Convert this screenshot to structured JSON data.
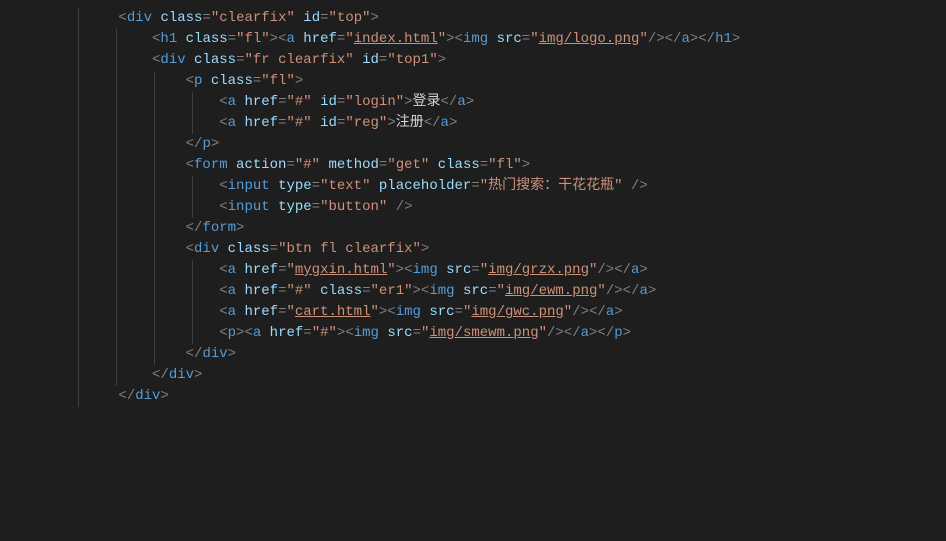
{
  "lines": [
    {
      "indent": 1,
      "segs": [
        {
          "t": "tag",
          "v": "<"
        },
        {
          "t": "tagname",
          "v": "div"
        },
        {
          "t": "txt",
          "v": " "
        },
        {
          "t": "attrname",
          "v": "class"
        },
        {
          "t": "tag",
          "v": "="
        },
        {
          "t": "attrval",
          "v": "\"clearfix\""
        },
        {
          "t": "txt",
          "v": " "
        },
        {
          "t": "attrname",
          "v": "id"
        },
        {
          "t": "tag",
          "v": "="
        },
        {
          "t": "attrval",
          "v": "\"top\""
        },
        {
          "t": "tag",
          "v": ">"
        }
      ]
    },
    {
      "indent": 2,
      "segs": [
        {
          "t": "tag",
          "v": "<"
        },
        {
          "t": "tagname",
          "v": "h1"
        },
        {
          "t": "txt",
          "v": " "
        },
        {
          "t": "attrname",
          "v": "class"
        },
        {
          "t": "tag",
          "v": "="
        },
        {
          "t": "attrval",
          "v": "\"fl\""
        },
        {
          "t": "tag",
          "v": "><"
        },
        {
          "t": "tagname",
          "v": "a"
        },
        {
          "t": "txt",
          "v": " "
        },
        {
          "t": "attrname",
          "v": "href"
        },
        {
          "t": "tag",
          "v": "="
        },
        {
          "t": "attrval",
          "v": "\""
        },
        {
          "t": "attrvalU",
          "v": "index.html"
        },
        {
          "t": "attrval",
          "v": "\""
        },
        {
          "t": "tag",
          "v": "><"
        },
        {
          "t": "tagname",
          "v": "img"
        },
        {
          "t": "txt",
          "v": " "
        },
        {
          "t": "attrname",
          "v": "src"
        },
        {
          "t": "tag",
          "v": "="
        },
        {
          "t": "attrval",
          "v": "\""
        },
        {
          "t": "attrvalU",
          "v": "img/logo.png"
        },
        {
          "t": "attrval",
          "v": "\""
        },
        {
          "t": "tag",
          "v": "/></"
        },
        {
          "t": "tagname",
          "v": "a"
        },
        {
          "t": "tag",
          "v": "></"
        },
        {
          "t": "tagname",
          "v": "h1"
        },
        {
          "t": "tag",
          "v": ">"
        }
      ]
    },
    {
      "indent": 2,
      "segs": [
        {
          "t": "tag",
          "v": "<"
        },
        {
          "t": "tagname",
          "v": "div"
        },
        {
          "t": "txt",
          "v": " "
        },
        {
          "t": "attrname",
          "v": "class"
        },
        {
          "t": "tag",
          "v": "="
        },
        {
          "t": "attrval",
          "v": "\"fr clearfix\""
        },
        {
          "t": "txt",
          "v": " "
        },
        {
          "t": "attrname",
          "v": "id"
        },
        {
          "t": "tag",
          "v": "="
        },
        {
          "t": "attrval",
          "v": "\"top1\""
        },
        {
          "t": "tag",
          "v": ">"
        }
      ]
    },
    {
      "indent": 3,
      "segs": [
        {
          "t": "tag",
          "v": "<"
        },
        {
          "t": "tagname",
          "v": "p"
        },
        {
          "t": "txt",
          "v": " "
        },
        {
          "t": "attrname",
          "v": "class"
        },
        {
          "t": "tag",
          "v": "="
        },
        {
          "t": "attrval",
          "v": "\"fl\""
        },
        {
          "t": "tag",
          "v": ">"
        }
      ]
    },
    {
      "indent": 4,
      "segs": [
        {
          "t": "tag",
          "v": "<"
        },
        {
          "t": "tagname",
          "v": "a"
        },
        {
          "t": "txt",
          "v": " "
        },
        {
          "t": "attrname",
          "v": "href"
        },
        {
          "t": "tag",
          "v": "="
        },
        {
          "t": "attrval",
          "v": "\"#\""
        },
        {
          "t": "txt",
          "v": " "
        },
        {
          "t": "attrname",
          "v": "id"
        },
        {
          "t": "tag",
          "v": "="
        },
        {
          "t": "attrval",
          "v": "\"login\""
        },
        {
          "t": "tag",
          "v": ">"
        },
        {
          "t": "txt",
          "v": "登录"
        },
        {
          "t": "tag",
          "v": "</"
        },
        {
          "t": "tagname",
          "v": "a"
        },
        {
          "t": "tag",
          "v": ">"
        }
      ]
    },
    {
      "indent": 4,
      "segs": [
        {
          "t": "tag",
          "v": "<"
        },
        {
          "t": "tagname",
          "v": "a"
        },
        {
          "t": "txt",
          "v": " "
        },
        {
          "t": "attrname",
          "v": "href"
        },
        {
          "t": "tag",
          "v": "="
        },
        {
          "t": "attrval",
          "v": "\"#\""
        },
        {
          "t": "txt",
          "v": " "
        },
        {
          "t": "attrname",
          "v": "id"
        },
        {
          "t": "tag",
          "v": "="
        },
        {
          "t": "attrval",
          "v": "\"reg\""
        },
        {
          "t": "tag",
          "v": ">"
        },
        {
          "t": "txt",
          "v": "注册"
        },
        {
          "t": "tag",
          "v": "</"
        },
        {
          "t": "tagname",
          "v": "a"
        },
        {
          "t": "tag",
          "v": ">"
        }
      ]
    },
    {
      "indent": 3,
      "segs": [
        {
          "t": "tag",
          "v": "</"
        },
        {
          "t": "tagname",
          "v": "p"
        },
        {
          "t": "tag",
          "v": ">"
        }
      ]
    },
    {
      "indent": 3,
      "segs": [
        {
          "t": "tag",
          "v": "<"
        },
        {
          "t": "tagname",
          "v": "form"
        },
        {
          "t": "txt",
          "v": " "
        },
        {
          "t": "attrname",
          "v": "action"
        },
        {
          "t": "tag",
          "v": "="
        },
        {
          "t": "attrval",
          "v": "\"#\""
        },
        {
          "t": "txt",
          "v": " "
        },
        {
          "t": "attrname",
          "v": "method"
        },
        {
          "t": "tag",
          "v": "="
        },
        {
          "t": "attrval",
          "v": "\"get\""
        },
        {
          "t": "txt",
          "v": " "
        },
        {
          "t": "attrname",
          "v": "class"
        },
        {
          "t": "tag",
          "v": "="
        },
        {
          "t": "attrval",
          "v": "\"fl\""
        },
        {
          "t": "tag",
          "v": ">"
        }
      ]
    },
    {
      "indent": 4,
      "segs": [
        {
          "t": "tag",
          "v": "<"
        },
        {
          "t": "tagname",
          "v": "input"
        },
        {
          "t": "txt",
          "v": " "
        },
        {
          "t": "attrname",
          "v": "type"
        },
        {
          "t": "tag",
          "v": "="
        },
        {
          "t": "attrval",
          "v": "\"text\""
        },
        {
          "t": "txt",
          "v": " "
        },
        {
          "t": "attrname",
          "v": "placeholder"
        },
        {
          "t": "tag",
          "v": "="
        },
        {
          "t": "attrval",
          "v": "\"热门搜索：干花花瓶\""
        },
        {
          "t": "txt",
          "v": " "
        },
        {
          "t": "tag",
          "v": "/>"
        }
      ]
    },
    {
      "indent": 4,
      "segs": [
        {
          "t": "tag",
          "v": "<"
        },
        {
          "t": "tagname",
          "v": "input"
        },
        {
          "t": "txt",
          "v": " "
        },
        {
          "t": "attrname",
          "v": "type"
        },
        {
          "t": "tag",
          "v": "="
        },
        {
          "t": "attrval",
          "v": "\"button\""
        },
        {
          "t": "txt",
          "v": " "
        },
        {
          "t": "tag",
          "v": "/>"
        }
      ]
    },
    {
      "indent": 3,
      "segs": [
        {
          "t": "tag",
          "v": "</"
        },
        {
          "t": "tagname",
          "v": "form"
        },
        {
          "t": "tag",
          "v": ">"
        }
      ]
    },
    {
      "indent": 3,
      "segs": [
        {
          "t": "tag",
          "v": "<"
        },
        {
          "t": "tagname",
          "v": "div"
        },
        {
          "t": "txt",
          "v": " "
        },
        {
          "t": "attrname",
          "v": "class"
        },
        {
          "t": "tag",
          "v": "="
        },
        {
          "t": "attrval",
          "v": "\"btn fl clearfix\""
        },
        {
          "t": "tag",
          "v": ">"
        }
      ]
    },
    {
      "indent": 4,
      "segs": [
        {
          "t": "tag",
          "v": "<"
        },
        {
          "t": "tagname",
          "v": "a"
        },
        {
          "t": "txt",
          "v": " "
        },
        {
          "t": "attrname",
          "v": "href"
        },
        {
          "t": "tag",
          "v": "="
        },
        {
          "t": "attrval",
          "v": "\""
        },
        {
          "t": "attrvalU",
          "v": "mygxin.html"
        },
        {
          "t": "attrval",
          "v": "\""
        },
        {
          "t": "tag",
          "v": "><"
        },
        {
          "t": "tagname",
          "v": "img"
        },
        {
          "t": "txt",
          "v": " "
        },
        {
          "t": "attrname",
          "v": "src"
        },
        {
          "t": "tag",
          "v": "="
        },
        {
          "t": "attrval",
          "v": "\""
        },
        {
          "t": "attrvalU",
          "v": "img/grzx.png"
        },
        {
          "t": "attrval",
          "v": "\""
        },
        {
          "t": "tag",
          "v": "/></"
        },
        {
          "t": "tagname",
          "v": "a"
        },
        {
          "t": "tag",
          "v": ">"
        }
      ]
    },
    {
      "indent": 4,
      "segs": [
        {
          "t": "tag",
          "v": "<"
        },
        {
          "t": "tagname",
          "v": "a"
        },
        {
          "t": "txt",
          "v": " "
        },
        {
          "t": "attrname",
          "v": "href"
        },
        {
          "t": "tag",
          "v": "="
        },
        {
          "t": "attrval",
          "v": "\"#\""
        },
        {
          "t": "txt",
          "v": " "
        },
        {
          "t": "attrname",
          "v": "class"
        },
        {
          "t": "tag",
          "v": "="
        },
        {
          "t": "attrval",
          "v": "\"er1\""
        },
        {
          "t": "tag",
          "v": "><"
        },
        {
          "t": "tagname",
          "v": "img"
        },
        {
          "t": "txt",
          "v": " "
        },
        {
          "t": "attrname",
          "v": "src"
        },
        {
          "t": "tag",
          "v": "="
        },
        {
          "t": "attrval",
          "v": "\""
        },
        {
          "t": "attrvalU",
          "v": "img/ewm.png"
        },
        {
          "t": "attrval",
          "v": "\""
        },
        {
          "t": "tag",
          "v": "/></"
        },
        {
          "t": "tagname",
          "v": "a"
        },
        {
          "t": "tag",
          "v": ">"
        }
      ]
    },
    {
      "indent": 4,
      "segs": [
        {
          "t": "tag",
          "v": "<"
        },
        {
          "t": "tagname",
          "v": "a"
        },
        {
          "t": "txt",
          "v": " "
        },
        {
          "t": "attrname",
          "v": "href"
        },
        {
          "t": "tag",
          "v": "="
        },
        {
          "t": "attrval",
          "v": "\""
        },
        {
          "t": "attrvalU",
          "v": "cart.html"
        },
        {
          "t": "attrval",
          "v": "\""
        },
        {
          "t": "tag",
          "v": "><"
        },
        {
          "t": "tagname",
          "v": "img"
        },
        {
          "t": "txt",
          "v": " "
        },
        {
          "t": "attrname",
          "v": "src"
        },
        {
          "t": "tag",
          "v": "="
        },
        {
          "t": "attrval",
          "v": "\""
        },
        {
          "t": "attrvalU",
          "v": "img/gwc.png"
        },
        {
          "t": "attrval",
          "v": "\""
        },
        {
          "t": "tag",
          "v": "/></"
        },
        {
          "t": "tagname",
          "v": "a"
        },
        {
          "t": "tag",
          "v": ">"
        }
      ]
    },
    {
      "indent": 4,
      "segs": [
        {
          "t": "tag",
          "v": "<"
        },
        {
          "t": "tagname",
          "v": "p"
        },
        {
          "t": "tag",
          "v": "><"
        },
        {
          "t": "tagname",
          "v": "a"
        },
        {
          "t": "txt",
          "v": " "
        },
        {
          "t": "attrname",
          "v": "href"
        },
        {
          "t": "tag",
          "v": "="
        },
        {
          "t": "attrval",
          "v": "\"#\""
        },
        {
          "t": "tag",
          "v": "><"
        },
        {
          "t": "tagname",
          "v": "img"
        },
        {
          "t": "txt",
          "v": " "
        },
        {
          "t": "attrname",
          "v": "src"
        },
        {
          "t": "tag",
          "v": "="
        },
        {
          "t": "attrval",
          "v": "\""
        },
        {
          "t": "attrvalU",
          "v": "img/smewm.png"
        },
        {
          "t": "attrval",
          "v": "\""
        },
        {
          "t": "tag",
          "v": "/></"
        },
        {
          "t": "tagname",
          "v": "a"
        },
        {
          "t": "tag",
          "v": "></"
        },
        {
          "t": "tagname",
          "v": "p"
        },
        {
          "t": "tag",
          "v": ">"
        }
      ]
    },
    {
      "indent": 3,
      "segs": [
        {
          "t": "tag",
          "v": "</"
        },
        {
          "t": "tagname",
          "v": "div"
        },
        {
          "t": "tag",
          "v": ">"
        }
      ]
    },
    {
      "indent": 2,
      "segs": [
        {
          "t": "tag",
          "v": "</"
        },
        {
          "t": "tagname",
          "v": "div"
        },
        {
          "t": "tag",
          "v": ">"
        }
      ]
    },
    {
      "indent": 1,
      "segs": [
        {
          "t": "tag",
          "v": "</"
        },
        {
          "t": "tagname",
          "v": "div"
        },
        {
          "t": "tag",
          "v": ">"
        }
      ]
    }
  ],
  "indentWidth": 38,
  "indentStart": 10,
  "guideStep": 38
}
